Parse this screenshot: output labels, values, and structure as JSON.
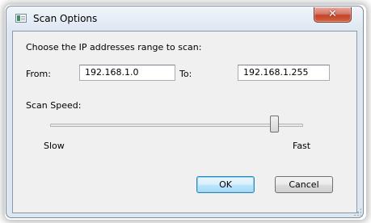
{
  "window": {
    "title": "Scan Options",
    "close_glyph": "✕"
  },
  "form": {
    "instruction": "Choose the IP addresses range to scan:",
    "from_label": "From:",
    "from_value": "192.168.1.0",
    "to_label": "To:",
    "to_value": "192.168.1.255",
    "speed_label": "Scan Speed:",
    "speed_min_label": "Slow",
    "speed_max_label": "Fast",
    "speed_level": 0.9
  },
  "buttons": {
    "ok_label": "OK",
    "cancel_label": "Cancel"
  },
  "colors": {
    "client_bg": "#f0f0f0",
    "close_red": "#c4432d",
    "default_button_border": "#3c7fb1"
  },
  "icons": {
    "app": "app-window-icon",
    "close": "close-icon",
    "resize": "resize-grip-icon"
  }
}
